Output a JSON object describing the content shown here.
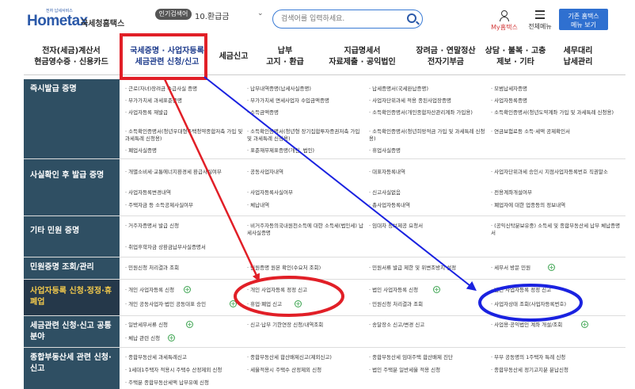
{
  "header": {
    "logo_main": "Hometax",
    "logo_sub": "전자 납세서비스",
    "logo_kr": "국세청홈택스",
    "popular_badge": "인기검색어",
    "popular_value": "10.환급금",
    "search_placeholder": "검색어를 입력하세요.",
    "my_hometax": "My홈택스",
    "menu_all": "전체메뉴",
    "old_hometax_button": "기존 홈택스\n메뉴 보기"
  },
  "nav": [
    {
      "label": "전자(세금)계산서\n현금영수증 · 신용카드"
    },
    {
      "label": "국세증명 · 사업자등록\n세금관련 신청/신고"
    },
    {
      "label": "세금신고"
    },
    {
      "label": "납부\n고지 · 환급"
    },
    {
      "label": "지급명세서\n자료제출 · 공익법인"
    },
    {
      "label": "장려금 · 연말정산\n전자기부금"
    },
    {
      "label": "상담 · 불복 · 고충\n제보 · 기타"
    },
    {
      "label": "세무대리\n납세관리"
    }
  ],
  "rows": [
    {
      "title": "즉시발급 증명",
      "cells": [
        [
          "· 근로(자녀)장려금 수급사실 증명",
          "· 납부내역증명(납세사실증명)",
          "· 납세증명서(국세완납증명)",
          "· 모범납세자증명"
        ],
        [
          "· 부가가치세 과세표준증명",
          "· 부가가치세 면세사업자 수입금액증명",
          "· 사업자단위과세 적용 종된사업장증명",
          "· 사업자등록증명"
        ],
        [
          "· 사업자등록 재발급",
          "· 소득금액증명",
          "· 소득확인증명서(개인종합자산관리계좌 가입용)",
          "· 소득확인증명서(청년도약계좌 가입 및 과세특례 신청용)"
        ],
        [
          "· 소득확인증명서(청년우대형주택청약종합저축 가입 및 과세특례 신청용)",
          "· 소득확인증명서(청년형 장기집합투자증권저축 가입 및 과세특례 신청용)",
          "· 소득확인증명서(청년희망적금 가입 및 과세특례 신청용)",
          "· 연금보험료등 소득·세액 공제확인서"
        ],
        [
          "· 폐업사실증명",
          "· 표준재무제표증명(개인, 법인)",
          "· 휴업사실증명",
          ""
        ]
      ]
    },
    {
      "title": "사실확인 후 발급 증명",
      "cells": [
        [
          "· 개별소비세·교통에너지환경세 환급사실여부",
          "· 공동사업자내역",
          "· 대표자등록내역",
          "· 사업자단위과세 승인시 지점사업자등록번호 직권말소"
        ],
        [
          "· 사업자등록변경내역",
          "· 사업자등록사실여부",
          "· 신고사실없음",
          "· 전용계좌개설여부"
        ],
        [
          "· 주택자금 등 소득공제사실여부",
          "· 체납내역",
          "· 총사업자등록내역",
          "· 폐업자에 대한 업종등의 정보내역"
        ]
      ]
    },
    {
      "title": "기타 민원 증명",
      "cells": [
        [
          "· 거주자증명서 발급 신청",
          "· 비거주자등의국내원천소득에 대한 소득세(법인세) 납세사실증명",
          "· 임대차 정보제공 요청서",
          "· (공익신탁분보유중) 소득세 및 종합부동산세 납부 체납증명서"
        ],
        [
          "· 취업후학자금 상환금납부사실증명서",
          "",
          "",
          ""
        ]
      ]
    },
    {
      "title": "민원증명 조회/관리",
      "cells": [
        [
          "· 민원신청 처리결과 조회",
          "· 민원증명 원본 확인(수요처 조회)",
          "· 민원서류 발급 제한 및 위변조방지 설정",
          "· 세무서 방문 민원"
        ]
      ]
    },
    {
      "title": "사업자등록 신청·정정·휴폐업",
      "cells": [
        [
          "· 개인 사업자등록 신청",
          "· 개인 사업자등록 정정 신고",
          "· 법인 사업자등록 신청",
          "· 법인 사업자등록 정정 신고"
        ],
        [
          "· 개인 공동사업자·법인 공동대표 승인",
          "· 휴업·폐업 신고",
          "· 민원신청 처리결과 조회",
          "· 사업자상태 조회(사업자등록번호)"
        ]
      ]
    },
    {
      "title": "세금관련 신청·신고 공통분야",
      "cells": [
        [
          "· 일반세무서류 신청",
          "· 신고·납부 기한연장 신청/내역조회",
          "· 송달장소 신고/변경 신고",
          "· 사업용·공익법인 계좌 개설/조회"
        ],
        [
          "· 체납 관련 신청",
          "",
          "",
          ""
        ]
      ]
    },
    {
      "title": "종합부동산세 관련 신청·신고",
      "cells": [
        [
          "· 종합부동산세 과세특례신고",
          "· 종합부동산세 합산배제신고(제외신고)",
          "· 종합부동산세 임대주택 합산배제 진단",
          "· 부부 공동명의 1주택자 특례 신청"
        ],
        [
          "· 1세대1주택자 적용시 주택수 산정제외 신청",
          "· 세율적용시 주택수 산정제외 신청",
          "· 법인 주택분 일반세율 적용 신청",
          "· 종합부동산세 정기고지분 분납신청"
        ],
        [
          "· 주택분 종합부동산세액 납부유예 신청",
          "",
          "",
          ""
        ]
      ]
    }
  ],
  "annotations": {
    "highlight_color": "#e11f27",
    "arrow_blue": "#1a22e0"
  }
}
